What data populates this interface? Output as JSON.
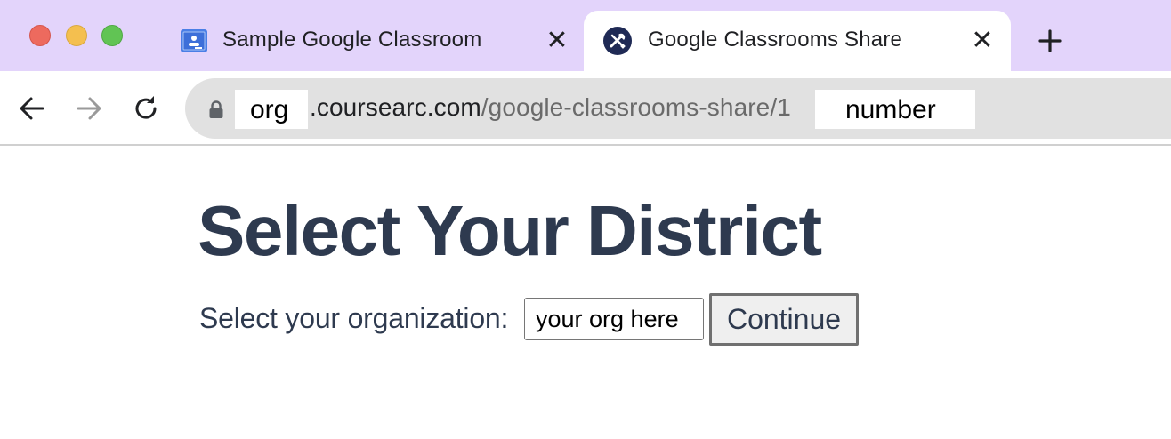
{
  "browser": {
    "tabs": [
      {
        "title": "Sample Google Classroom",
        "favicon": "google-classroom-icon",
        "active": false
      },
      {
        "title": "Google Classrooms Share",
        "favicon": "tools-icon",
        "active": true
      }
    ],
    "close_glyph": "✕",
    "address_bar": {
      "redacted_org": "org",
      "host_suffix": ".coursearc.com",
      "path": "/google-classrooms-share/1",
      "redacted_number": "number"
    },
    "colors": {
      "tabstrip": "#e3d4fb",
      "omnibox": "#e1e1e1"
    }
  },
  "page": {
    "title": "Select Your District",
    "org_label": "Select your organization:",
    "org_input_value": "your org here",
    "continue_label": "Continue",
    "text_color": "#2e3a4f"
  }
}
